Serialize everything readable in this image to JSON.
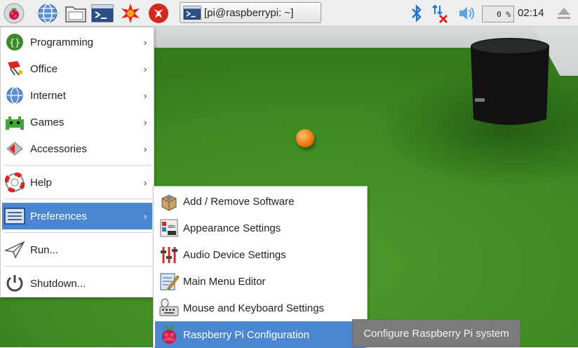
{
  "taskbar": {
    "terminal_task": "[pi@raspberrypi: ~]",
    "cpu_usage": "0 %",
    "clock": "02:14",
    "icons": [
      "raspberry-menu-icon",
      "browser-icon",
      "file-manager-icon",
      "terminal-icon",
      "math-icon",
      "wolfram-icon",
      "bluetooth-icon",
      "network-disconnected-icon",
      "volume-icon",
      "eject-icon"
    ]
  },
  "main_menu": {
    "items": [
      {
        "label": "Programming",
        "icon": "programming-icon"
      },
      {
        "label": "Office",
        "icon": "office-icon"
      },
      {
        "label": "Internet",
        "icon": "internet-icon"
      },
      {
        "label": "Games",
        "icon": "games-icon"
      },
      {
        "label": "Accessories",
        "icon": "accessories-icon"
      },
      {
        "label": "Help",
        "icon": "help-icon"
      },
      {
        "label": "Preferences",
        "icon": "preferences-icon"
      },
      {
        "label": "Run...",
        "icon": "run-icon"
      },
      {
        "label": "Shutdown...",
        "icon": "shutdown-icon"
      }
    ]
  },
  "preferences_menu": {
    "items": [
      {
        "label": "Add / Remove Software",
        "icon": "package-icon"
      },
      {
        "label": "Appearance Settings",
        "icon": "appearance-icon"
      },
      {
        "label": "Audio Device Settings",
        "icon": "audio-mixer-icon"
      },
      {
        "label": "Main Menu Editor",
        "icon": "menu-editor-icon"
      },
      {
        "label": "Mouse and Keyboard Settings",
        "icon": "mouse-keyboard-icon"
      },
      {
        "label": "Raspberry Pi Configuration",
        "icon": "raspberry-config-icon"
      }
    ]
  },
  "tooltip": "Configure Raspberry Pi system",
  "colors": {
    "highlight": "#4a86d1",
    "tooltip_bg": "#7b7b7b",
    "taskbar_bg": "#edeeef"
  }
}
